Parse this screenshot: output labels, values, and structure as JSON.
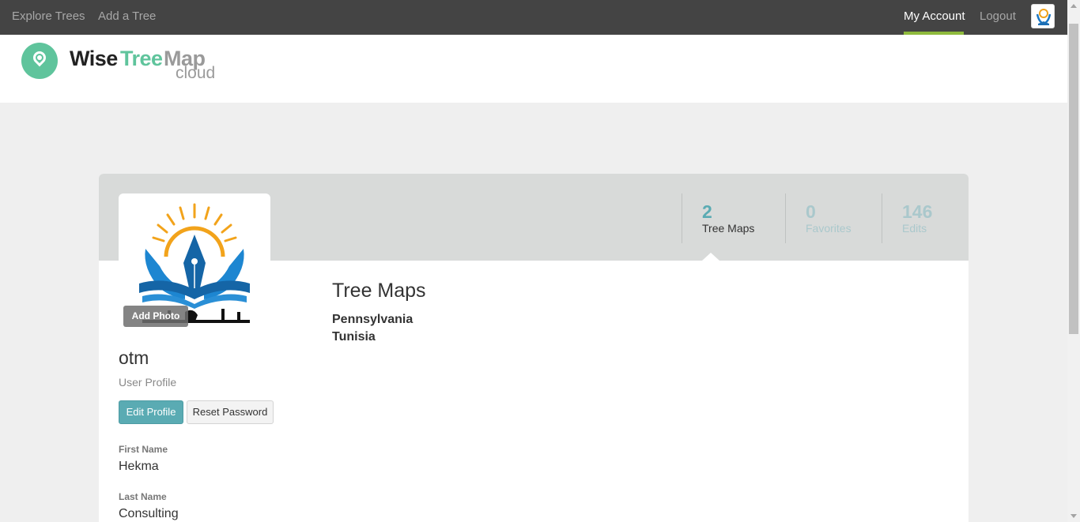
{
  "nav": {
    "left_links": [
      "Explore Trees",
      "Add a Tree"
    ],
    "my_account": "My Account",
    "logout": "Logout",
    "avatar_icon": "hekma-logo-icon",
    "active_color": "#8fba3c"
  },
  "logo": {
    "wise": "Wise",
    "tree": "Tree",
    "map": "Map",
    "cloud": "cloud",
    "brand_color": "#5fc49c"
  },
  "profile": {
    "username": "otm",
    "subtitle": "User Profile",
    "add_photo": "Add Photo",
    "edit_profile": "Edit Profile",
    "reset_password": "Reset Password",
    "fields": [
      {
        "label": "First Name",
        "value": "Hekma"
      },
      {
        "label": "Last Name",
        "value": "Consulting"
      }
    ]
  },
  "stats": [
    {
      "value": "2",
      "label": "Tree Maps",
      "active": true
    },
    {
      "value": "0",
      "label": "Favorites",
      "active": false
    },
    {
      "value": "146",
      "label": "Edits",
      "active": false
    }
  ],
  "tree_maps": {
    "title": "Tree Maps",
    "items": [
      "Pennsylvania",
      "Tunisia"
    ]
  },
  "colors": {
    "accent": "#5aabb3",
    "nav_bg": "#444444"
  }
}
